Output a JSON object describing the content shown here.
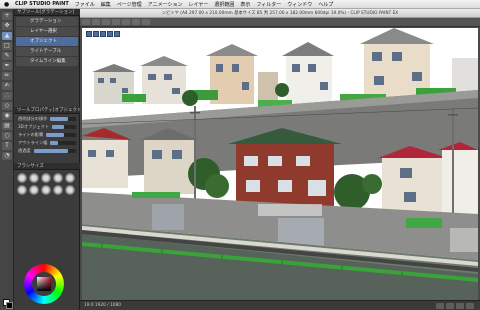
{
  "menubar": {
    "app_name": "CLIP STUDIO PAINT",
    "items": [
      "ファイル",
      "編集",
      "ページ管理",
      "アニメーション",
      "レイヤー",
      "選択範囲",
      "表示",
      "フィルター",
      "ウィンドウ",
      "ヘルプ"
    ]
  },
  "canvas": {
    "window_title": "ンビトヤ (A4 297.00 x 210.00mm 基本サイズ B5 判 257.00 x 182.00mm 600dpi 19.0%) - CLIP STUDIO PAINT EX",
    "zoom_label": "19.0"
  },
  "subtool_panel": {
    "title": "サブツール[グラデーション]",
    "items": [
      "グラデーション",
      "レイヤー選択",
      "オブジェクト",
      "ライトテーブル",
      "タイムライン編集"
    ]
  },
  "tool_property": {
    "title": "ツールプロパティ[オブジェクト]",
    "rows": [
      {
        "label": "透明部分の操作",
        "value": 0.7
      },
      {
        "label": "3Dオブジェクト",
        "value": 0.5
      },
      {
        "label": "ライトの影響",
        "value": 0.6
      },
      {
        "label": "アウトライン幅",
        "value": 0.3
      },
      {
        "label": "透過度",
        "value": 0.8
      }
    ]
  },
  "brush_panel": {
    "title": "ブラシサイズ"
  },
  "colors": {
    "main": "#ffffff",
    "sub": "#000000",
    "accent": "#4e6c9e"
  },
  "status": {
    "text": "19.0   1920 / 1080"
  }
}
